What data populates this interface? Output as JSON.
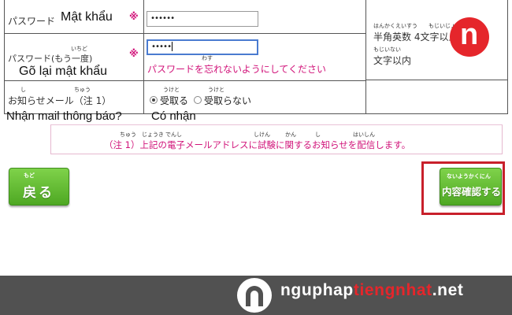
{
  "form": {
    "password": {
      "label_jp": "パスワード",
      "label_vi": "Mật khẩu",
      "required_mark": "※",
      "value": "••••••"
    },
    "password_confirm": {
      "label_jp": "パスワード(もう一度)",
      "label_vi": "Gõ lại mật khẩu",
      "required_mark": "※",
      "value": "•••••",
      "ruby_ichido": "いちど",
      "warning": "パスワードを忘れないようにしてください",
      "ruby_wasure": "わす"
    },
    "hint": {
      "ruby_line1": "はんかくえいすう",
      "ruby_line1b": "もじいじょう",
      "line1": "半角英数 4文字以上",
      "ruby_line2": "もじいない",
      "line2": "文字以内"
    },
    "notify": {
      "label_jp": "お知らせメール（注 1）",
      "label_vi": "Nhận mail thông báo?",
      "ruby_shi": "し",
      "ruby_chu": "ちゅう",
      "option_yes": "受取る",
      "option_yes_vi": "Có nhận",
      "option_no": "受取らない",
      "ruby_uketo": "うけと",
      "ruby_uketo2": "うけと",
      "selected": "受取る"
    },
    "note": {
      "text": "（注 1）上記の電子メールアドレスに試験に関するお知らせを配信します。",
      "ruby_chu": "ちゅう",
      "ruby_jouki": "じょうき",
      "ruby_denshi": "でんし",
      "ruby_shiken": "しけん",
      "ruby_kan": "かん",
      "ruby_shi": "し",
      "ruby_haishin": "はいしん"
    }
  },
  "buttons": {
    "back": {
      "label": "戻る",
      "ruby": "もど"
    },
    "confirm": {
      "label": "内容確認する",
      "ruby": "ないようかくにん"
    }
  },
  "watermark": {
    "letter": "n"
  },
  "footer": {
    "site_part1": "nguphap",
    "site_part2": "tiengnhat",
    "site_part3": ".net"
  },
  "colors": {
    "accent_pink": "#d1147a",
    "button_green": "#5fb92e",
    "highlight_red": "#c8202b",
    "footer_bg": "#515151",
    "brand_red": "#e5262b"
  }
}
